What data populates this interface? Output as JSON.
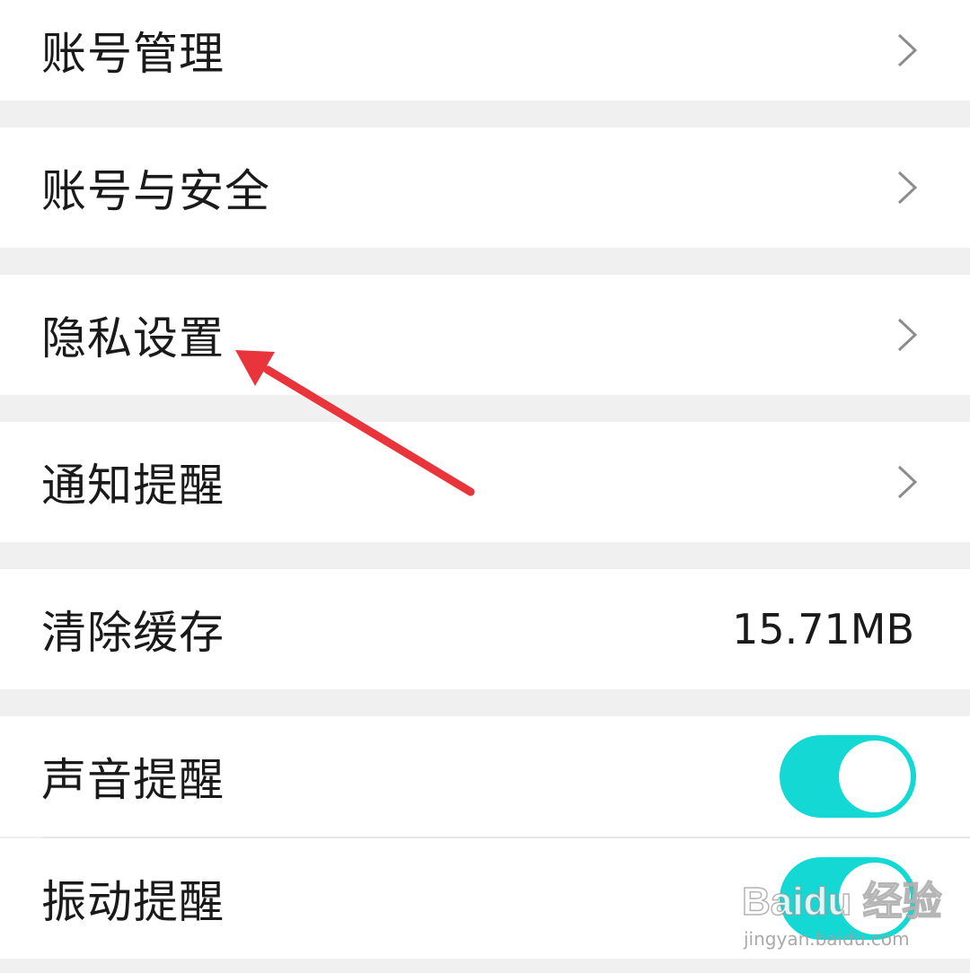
{
  "settings": {
    "account_management": {
      "label": "账号管理"
    },
    "account_security": {
      "label": "账号与安全"
    },
    "privacy": {
      "label": "隐私设置"
    },
    "notifications": {
      "label": "通知提醒"
    },
    "clear_cache": {
      "label": "清除缓存",
      "value": "15.71MB"
    },
    "sound_alert": {
      "label": "声音提醒",
      "enabled": true
    },
    "vibration_alert": {
      "label": "振动提醒",
      "enabled": true
    }
  },
  "icons": {
    "row_action": "chevron-right-icon"
  },
  "colors": {
    "toggle_on": "#13d8d3",
    "annotation_arrow": "#e8343a",
    "page_background": "#f0f0f0"
  },
  "watermark": {
    "brand": "Baidu 经验",
    "url": "jingyan.baidu.com"
  }
}
